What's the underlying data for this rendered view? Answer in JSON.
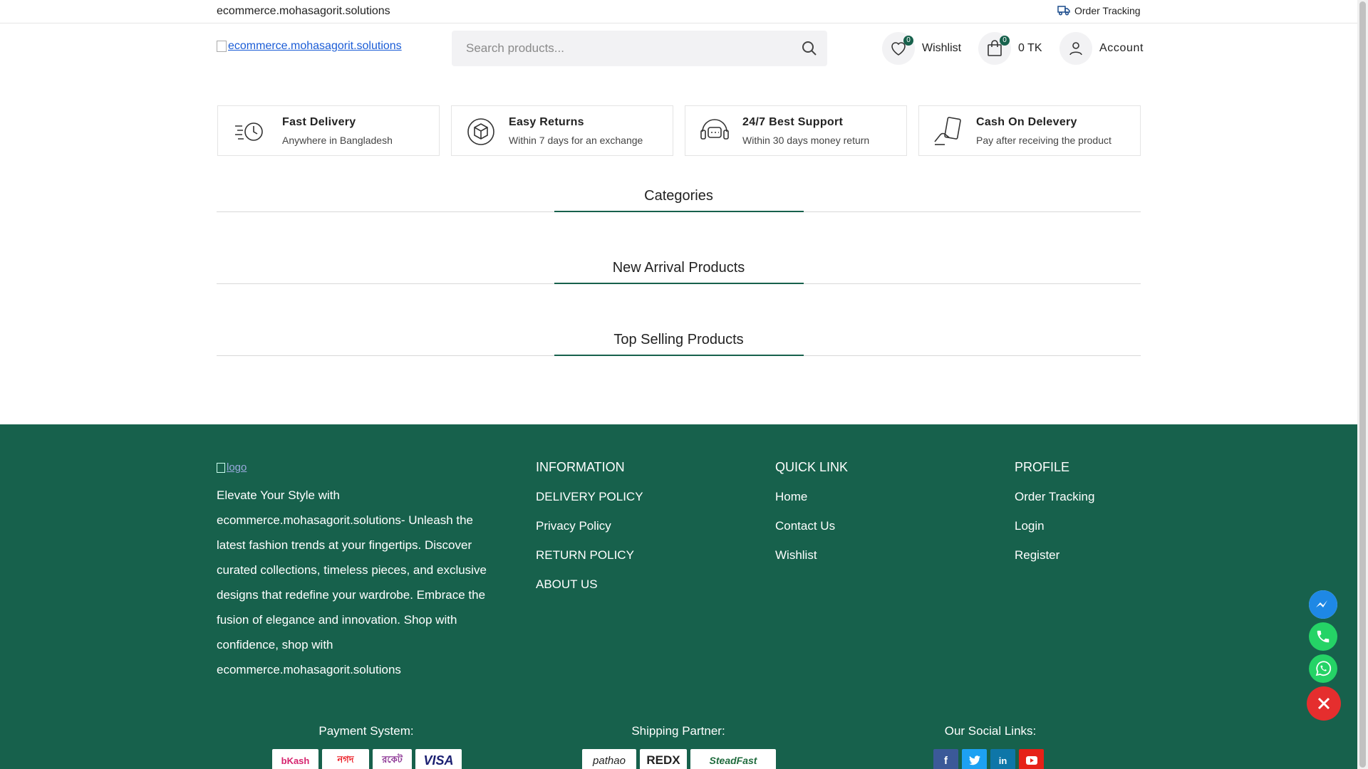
{
  "topbar": {
    "site_name": "ecommerce.mohasagorit.solutions",
    "order_tracking": "Order Tracking"
  },
  "header": {
    "logo_alt": "ecommerce.mohasagorit.solutions",
    "search_placeholder": "Search products...",
    "wishlist": {
      "count": "0",
      "label": "Wishlist"
    },
    "cart": {
      "count": "0",
      "label": "0 TK"
    },
    "account": {
      "label": "Account"
    }
  },
  "features": [
    {
      "title": "Fast Delivery",
      "subtitle": "Anywhere in Bangladesh",
      "icon": "fast-delivery-icon"
    },
    {
      "title": "Easy Returns",
      "subtitle": "Within 7 days for an exchange",
      "icon": "return-box-icon"
    },
    {
      "title": "24/7 Best Support",
      "subtitle": "Within 30 days money return",
      "icon": "support-headset-icon"
    },
    {
      "title": "Cash On Delevery",
      "subtitle": "Pay after receiving the product",
      "icon": "cash-hand-icon"
    }
  ],
  "sections": {
    "categories": "Categories",
    "new_arrival": "New Arrival Products",
    "top_selling": "Top Selling Products"
  },
  "footer": {
    "logo_alt": "logo",
    "about": "Elevate Your Style with ecommerce.mohasagorit.solutions- Unleash the latest fashion trends at your fingertips. Discover curated collections, timeless pieces, and exclusive designs that redefine your wardrobe. Embrace the fusion of elegance and innovation. Shop with confidence, shop with ecommerce.mohasagorit.solutions",
    "information": {
      "title": "INFORMATION",
      "links": [
        "DELIVERY POLICY",
        "Privacy Policy",
        "RETURN POLICY",
        "ABOUT US"
      ]
    },
    "quick_link": {
      "title": "QUICK LINK",
      "links": [
        "Home",
        "Contact Us",
        "Wishlist"
      ]
    },
    "profile": {
      "title": "PROFILE",
      "links": [
        "Order Tracking",
        "Login",
        "Register"
      ]
    },
    "payment_label": "Payment System:",
    "payment_methods": [
      "bKash",
      "নগদ",
      "রকেট",
      "VISA"
    ],
    "shipping_label": "Shipping Partner:",
    "shipping_partners": [
      "pathao",
      "REDX",
      "SteadFast"
    ],
    "social_label": "Our Social Links:",
    "social": [
      "facebook",
      "twitter",
      "linkedin",
      "youtube"
    ]
  },
  "colors": {
    "brand": "#17614c",
    "close": "#e52e2e",
    "messenger": "#1e88e5",
    "phone": "#25d366",
    "whatsapp": "#25d366"
  }
}
